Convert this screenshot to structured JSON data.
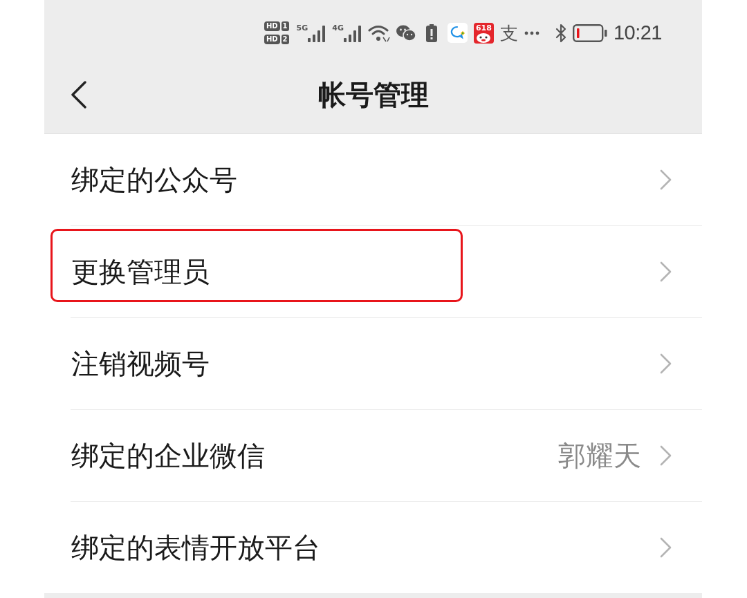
{
  "status_bar": {
    "sim_badges": [
      {
        "label": "HD",
        "slot": "1"
      },
      {
        "label": "HD",
        "slot": "2"
      }
    ],
    "networks": [
      "5G",
      "4G"
    ],
    "app_badge": "618",
    "glyph": "支",
    "time": "10:21"
  },
  "nav_bar": {
    "title": "帐号管理"
  },
  "rows": [
    {
      "label": "绑定的公众号",
      "highlighted": false
    },
    {
      "label": "更换管理员",
      "highlighted": true
    },
    {
      "label": "注销视频号",
      "highlighted": false
    },
    {
      "label": "绑定的企业微信",
      "value": "郭耀天",
      "highlighted": false
    },
    {
      "label": "绑定的表情开放平台",
      "highlighted": false
    }
  ]
}
